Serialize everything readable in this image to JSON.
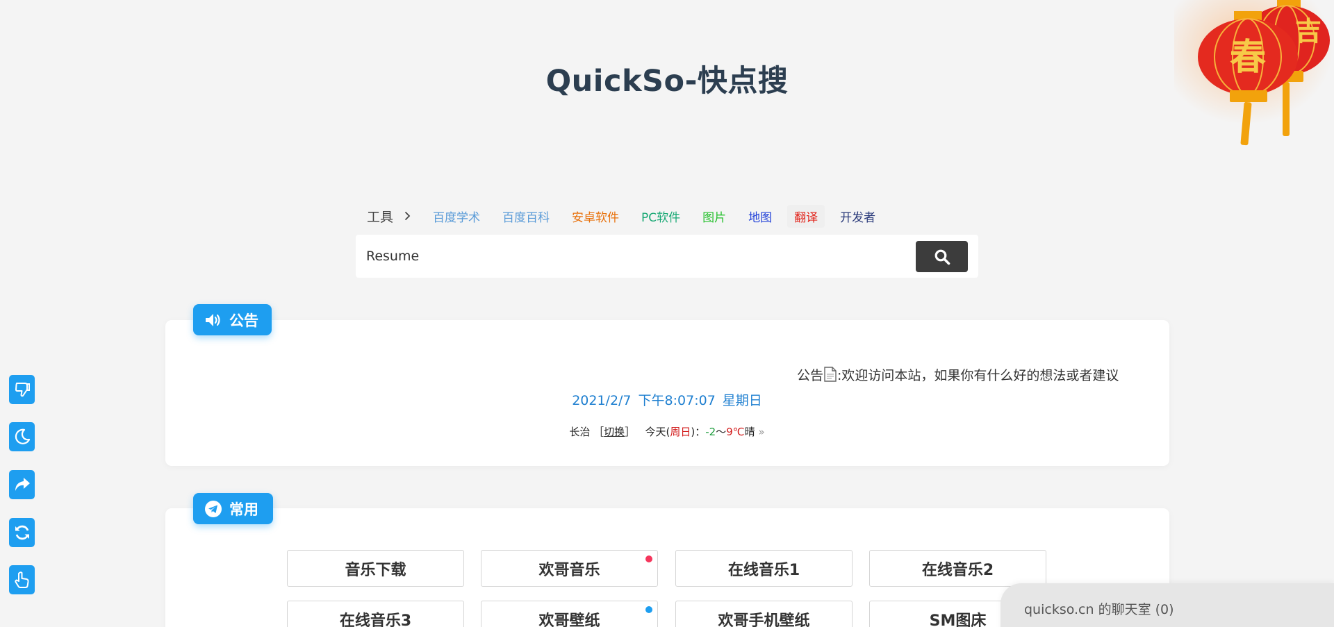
{
  "site": {
    "title": "QuickSo-快点搜"
  },
  "search": {
    "tools_label": "工具",
    "nav": [
      {
        "label": "百度学术",
        "color": "#5a9bd8"
      },
      {
        "label": "百度百科",
        "color": "#5a9bd8"
      },
      {
        "label": "安卓软件",
        "color": "#e8700a"
      },
      {
        "label": "PC软件",
        "color": "#18a874"
      },
      {
        "label": "图片",
        "color": "#25c02c"
      },
      {
        "label": "地图",
        "color": "#2140d8"
      },
      {
        "label": "翻译",
        "color": "#e2231a",
        "active": true
      },
      {
        "label": "开发者",
        "color": "#2a3a7a"
      }
    ],
    "query": "Resume",
    "button_icon": "search-icon"
  },
  "notice": {
    "badge": "公告",
    "badge_icon": "speaker-icon",
    "text_prefix": "公告",
    "text_main": ":欢迎访问本站，如果你有什么好的想法或者建议",
    "date": "2021/2/7",
    "time": "下午8:07:07",
    "weekday": "星期日",
    "weather": {
      "city": "长治",
      "switch": "切换",
      "today": "今天",
      "day": "周日",
      "low": "-2",
      "high": "9℃",
      "condition": "晴",
      "more": "»"
    }
  },
  "common": {
    "badge": "常用",
    "badge_icon": "telegram-icon",
    "links": [
      {
        "label": "音乐下载"
      },
      {
        "label": "欢哥音乐",
        "dot": "#f5365c"
      },
      {
        "label": "在线音乐1"
      },
      {
        "label": "在线音乐2"
      },
      {
        "label": "在线音乐3"
      },
      {
        "label": "欢哥壁纸",
        "dot": "#1e9ef0"
      },
      {
        "label": "欢哥手机壁纸"
      },
      {
        "label": "SM图床"
      }
    ]
  },
  "sidebar": {
    "buttons": [
      "thumbs-down-icon",
      "moon-icon",
      "share-icon",
      "refresh-icon",
      "pointer-icon"
    ]
  },
  "chat": {
    "label": "quickso.cn 的聊天室 (0)"
  },
  "decor": {
    "lantern_char": "春"
  }
}
